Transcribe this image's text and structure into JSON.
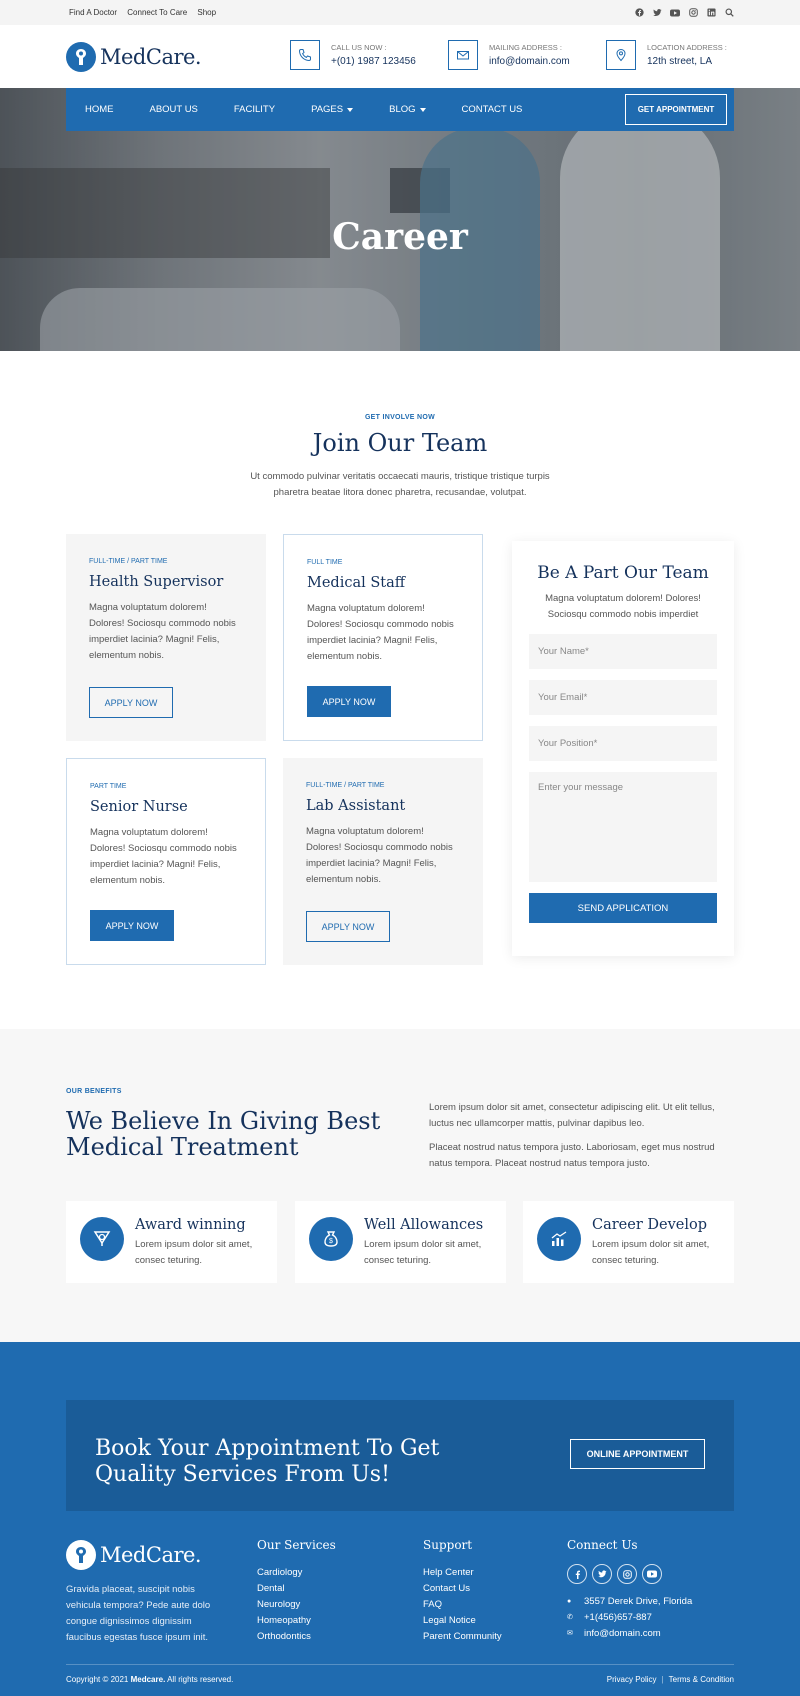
{
  "topbar": {
    "links": [
      "Find A Doctor",
      "Connect To Care",
      "Shop"
    ],
    "social_icons": [
      "facebook-icon",
      "twitter-icon",
      "youtube-icon",
      "instagram-icon",
      "linkedin-icon",
      "search-icon"
    ]
  },
  "header": {
    "logo": "MedCare.",
    "contacts": [
      {
        "icon": "phone-icon",
        "label": "CALL US NOW :",
        "value": "+(01) 1987 123456"
      },
      {
        "icon": "envelope-icon",
        "label": "MAILING ADDRESS :",
        "value": "info@domain.com"
      },
      {
        "icon": "location-pin-icon",
        "label": "LOCATION ADDRESS :",
        "value": "12th street, LA"
      }
    ]
  },
  "nav": {
    "items": [
      "HOME",
      "ABOUT US",
      "FACILITY",
      "PAGES",
      "BLOG",
      "CONTACT US"
    ],
    "appointment": "GET APPOINTMENT"
  },
  "hero": {
    "title": "Career"
  },
  "join": {
    "kicker": "GET INVOLVE NOW",
    "title": "Join Our Team",
    "desc": "Ut commodo pulvinar veritatis occaecati mauris, tristique tristique turpis pharetra beatae litora donec pharetra, recusandae, volutpat.",
    "jobs": [
      {
        "type": "FULL-TIME / PART TIME",
        "title": "Health Supervisor",
        "desc": "Magna voluptatum dolorem! Dolores! Sociosqu commodo nobis imperdiet lacinia? Magni! Felis, elementum nobis.",
        "button": "APPLY NOW"
      },
      {
        "type": "FULL TIME",
        "title": "Medical Staff",
        "desc": "Magna voluptatum dolorem! Dolores! Sociosqu commodo nobis imperdiet lacinia? Magni! Felis, elementum nobis.",
        "button": "APPLY NOW"
      },
      {
        "type": "PART TIME",
        "title": "Senior Nurse",
        "desc": "Magna voluptatum dolorem! Dolores! Sociosqu commodo nobis imperdiet lacinia? Magni! Felis, elementum nobis.",
        "button": "APPLY NOW"
      },
      {
        "type": "FULL-TIME / PART TIME",
        "title": "Lab Assistant",
        "desc": "Magna voluptatum dolorem! Dolores! Sociosqu commodo nobis imperdiet lacinia? Magni! Felis, elementum nobis.",
        "button": "APPLY NOW"
      }
    ],
    "form": {
      "title": "Be A Part Our Team",
      "desc": "Magna voluptatum dolorem! Dolores! Sociosqu commodo nobis imperdiet",
      "name_placeholder": "Your Name*",
      "email_placeholder": "Your Email*",
      "position_placeholder": "Your Position*",
      "message_placeholder": "Enter your message",
      "submit": "SEND APPLICATION"
    }
  },
  "benefits": {
    "kicker": "OUR BENEFITS",
    "title": "We Believe In Giving Best Medical Treatment",
    "text1": "Lorem ipsum dolor sit amet, consectetur adipiscing elit. Ut elit tellus, luctus nec ullamcorper mattis, pulvinar dapibus leo.",
    "text2": "Placeat nostrud natus tempora justo. Laboriosam, eget mus nostrud natus tempora. Placeat nostrud natus tempora justo.",
    "cards": [
      {
        "icon": "award-icon",
        "title": "Award winning",
        "desc": "Lorem ipsum dolor sit amet, consec teturing."
      },
      {
        "icon": "money-bag-icon",
        "title": "Well Allowances",
        "desc": "Lorem ipsum dolor sit amet, consec teturing."
      },
      {
        "icon": "growth-chart-icon",
        "title": "Career Develop",
        "desc": "Lorem ipsum dolor sit amet, consec teturing."
      }
    ]
  },
  "footer": {
    "cta_title": "Book Your Appointment To Get Quality Services From Us!",
    "cta_button": "ONLINE APPOINTMENT",
    "logo": "MedCare.",
    "desc": "Gravida placeat, suscipit nobis vehicula tempora? Pede aute dolo congue dignissimos dignissim faucibus egestas fusce ipsum init.",
    "services_title": "Our Services",
    "services": [
      "Cardiology",
      "Dental",
      "Neurology",
      "Homeopathy",
      "Orthodontics"
    ],
    "support_title": "Support",
    "support": [
      "Help Center",
      "Contact Us",
      "FAQ",
      "Legal Notice",
      "Parent Community"
    ],
    "connect_title": "Connect Us",
    "address": "3557 Derek Drive, Florida",
    "phone": "+1(456)657-887",
    "email": "info@domain.com",
    "copyright_prefix": "Copyright © 2021 ",
    "copyright_brand": "Medcare.",
    "copyright_suffix": " All rights reserved.",
    "privacy": "Privacy Policy",
    "terms": "Terms & Condition"
  },
  "colors": {
    "primary": "#1f6bb0",
    "heading": "#15325c",
    "light_bg": "#f5f5f5"
  }
}
